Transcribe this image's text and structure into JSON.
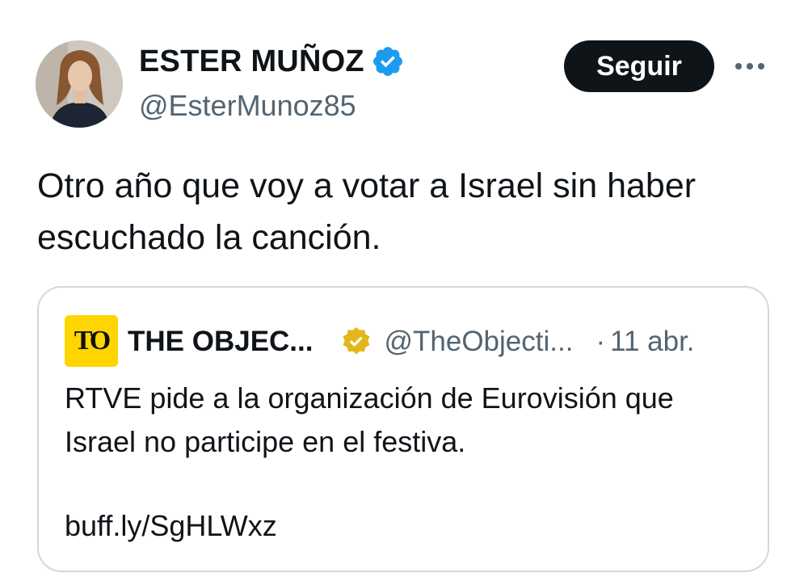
{
  "author": {
    "display_name": "ESTER MUÑOZ",
    "handle": "@EsterMunoz85",
    "verified_color": "#1d9bf0"
  },
  "actions": {
    "follow_label": "Seguir",
    "more_icon": "more-horizontal-icon"
  },
  "tweet": {
    "text": "Otro año que voy a votar a Israel sin haber escuchado la canción."
  },
  "quoted_tweet": {
    "avatar_text": "TO",
    "avatar_color": "#ffd500",
    "display_name": "THE OBJEC...",
    "verified_color": "#e2b719",
    "handle": "@TheObjecti...",
    "separator": "·",
    "date": "11 abr.",
    "text": "RTVE pide a la organización de Eurovisión que Israel no participe en el festiva.",
    "link": "buff.ly/SgHLWxz"
  },
  "colors": {
    "text_primary": "#0f1419",
    "text_secondary": "#536471",
    "border": "#cfd9de",
    "button_bg": "#0f1419"
  }
}
